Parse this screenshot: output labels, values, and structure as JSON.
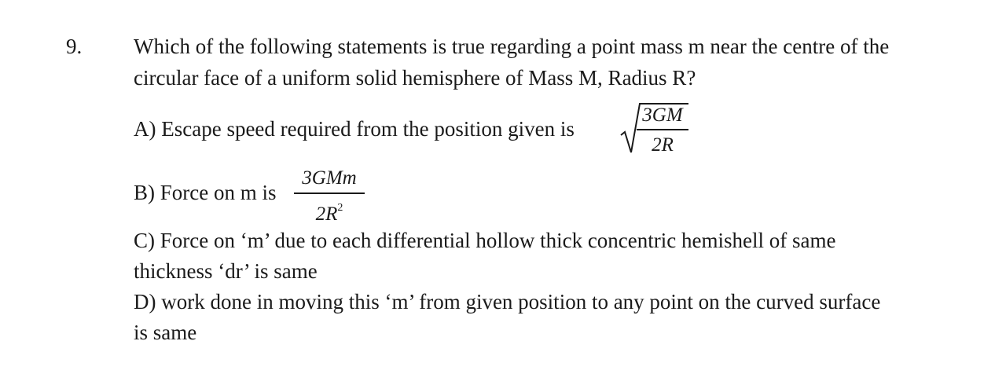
{
  "question": {
    "number": "9.",
    "stem_line1": "Which of the following statements is true regarding a point mass m near the centre of the",
    "stem_line2": "circular face of a uniform solid hemisphere of Mass M, Radius R?"
  },
  "options": {
    "a": {
      "text": "A) Escape speed required from the position given is",
      "fraction_numerator": "3GM",
      "fraction_denominator": "2R"
    },
    "b": {
      "text": "B) Force on m is",
      "fraction_numerator": "3GMm",
      "fraction_denominator_base": "2R",
      "fraction_denominator_exp": "2"
    },
    "c": {
      "line1": "C) Force on ‘m’ due to each differential hollow thick concentric hemishell of same",
      "line2": "thickness ‘dr’ is same"
    },
    "d": {
      "line1": "D) work done in moving this ‘m’ from given position to any point on the curved surface",
      "line2": "is same"
    }
  }
}
